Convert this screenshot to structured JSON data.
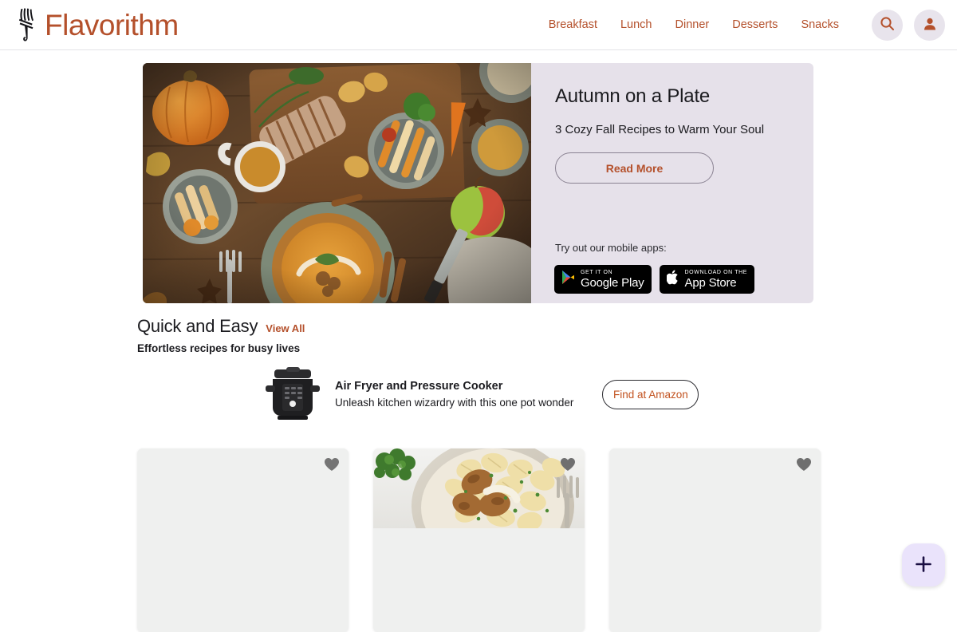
{
  "header": {
    "brand_name": "Flavorithm",
    "brand_icon": "whisk-fork-logo-icon",
    "brand_color": "#b4502b",
    "nav_items": [
      {
        "label": "Breakfast"
      },
      {
        "label": "Lunch"
      },
      {
        "label": "Dinner"
      },
      {
        "label": "Desserts"
      },
      {
        "label": "Snacks"
      }
    ],
    "search_icon": "search-icon",
    "account_icon": "user-avatar-icon"
  },
  "hero": {
    "image_alt": "autumn-feast-table-photo",
    "title": "Autumn on a Plate",
    "subtitle": "3 Cozy Fall Recipes to Warm Your Soul",
    "cta_label": "Read More",
    "apps_label": "Try out our mobile apps:",
    "badges": [
      {
        "small": "GET IT ON",
        "big": "Google Play",
        "icon": "google-play-icon"
      },
      {
        "small": "Download on the",
        "big": "App Store",
        "icon": "apple-icon"
      }
    ],
    "panel_color": "#e6e1ea"
  },
  "section": {
    "title": "Quick and Easy",
    "view_all_label": "View All",
    "subtitle": "Effortless recipes for busy lives"
  },
  "ad": {
    "image_alt": "air-fryer-pressure-cooker-photo",
    "title": "Air Fryer and Pressure Cooker",
    "description": "Unleash kitchen wizardry with this one pot wonder",
    "cta_label": "Find at Amazon"
  },
  "cards": [
    {
      "image_alt": "",
      "favorite_icon": "heart-icon",
      "has_image": false
    },
    {
      "image_alt": "creamy-chicken-pasta-photo",
      "favorite_icon": "heart-icon",
      "has_image": true
    },
    {
      "image_alt": "",
      "favorite_icon": "heart-icon",
      "has_image": false
    }
  ],
  "fab": {
    "icon": "plus-icon",
    "color": "#eae3fb"
  }
}
